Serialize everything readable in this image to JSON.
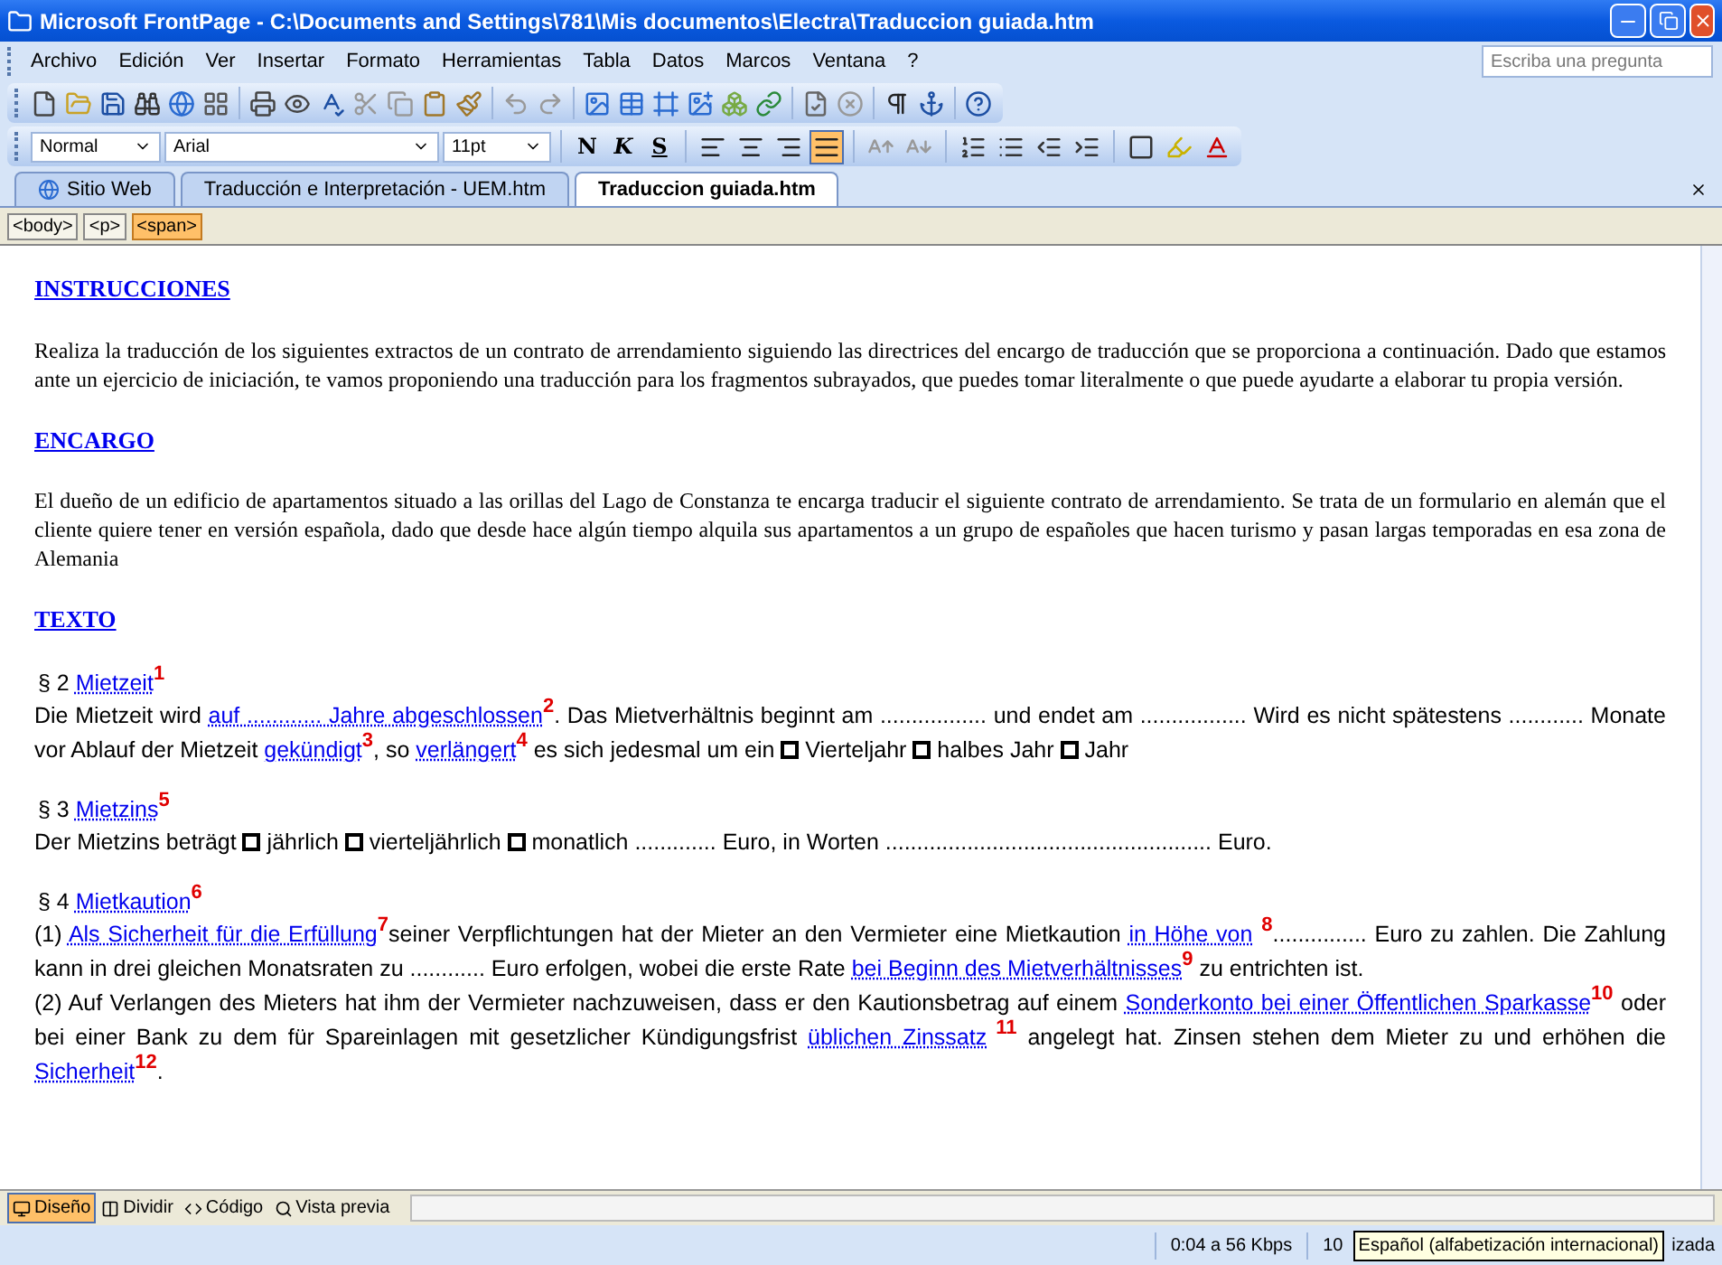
{
  "window": {
    "title": "Microsoft FrontPage - C:\\Documents and Settings\\781\\Mis documentos\\Electra\\Traduccion guiada.htm"
  },
  "menu": [
    "Archivo",
    "Edición",
    "Ver",
    "Insertar",
    "Formato",
    "Herramientas",
    "Tabla",
    "Datos",
    "Marcos",
    "Ventana",
    "?"
  ],
  "help_box": {
    "placeholder": "Escriba una pregunta"
  },
  "format_toolbar": {
    "style": "Normal",
    "font": "Arial",
    "size": "11pt",
    "text_buttons": [
      {
        "kind": "bold",
        "label": "N"
      },
      {
        "kind": "italic",
        "label": "K"
      },
      {
        "kind": "underline",
        "label": "S"
      }
    ],
    "alignment": [
      {
        "kind": "left",
        "selected": false
      },
      {
        "kind": "center",
        "selected": false
      },
      {
        "kind": "right",
        "selected": false
      },
      {
        "kind": "justify",
        "selected": true
      }
    ]
  },
  "tabs": [
    {
      "label": "Sitio Web",
      "kind": "site",
      "selected": false
    },
    {
      "label": "Traducción e Interpretación - UEM.htm",
      "kind": "page",
      "selected": false
    },
    {
      "label": "Traduccion guiada.htm",
      "kind": "page",
      "selected": true
    }
  ],
  "tag_bar": [
    {
      "label": "<body>",
      "selected": false
    },
    {
      "label": "<p>",
      "selected": false
    },
    {
      "label": "<span>",
      "selected": true
    }
  ],
  "document": [
    {
      "kind": "heading",
      "text": "INSTRUCCIONES"
    },
    {
      "kind": "intro",
      "runs": [
        {
          "kind": "text",
          "text": "Realiza la traducción de los siguientes extractos de un contrato de arrendamiento siguiendo las directrices del encargo de traducción que se proporciona a continuación. Dado que estamos ante un ejercicio de iniciación, te vamos proponiendo una traducción para los fragmentos subrayados, que puedes tomar literalmente o  que puede ayudarte a elaborar tu propia versión."
        }
      ]
    },
    {
      "kind": "heading",
      "text": "ENCARGO"
    },
    {
      "kind": "intro",
      "runs": [
        {
          "kind": "text",
          "text": "El dueño de un edificio de apartamentos situado a las orillas del Lago de Constanza  te encarga traducir el siguiente contrato de arrendamiento. Se trata de un formulario en alemán que el cliente quiere tener en versión española, dado que desde hace algún tiempo alquila sus apartamentos a un grupo de españoles que hacen turismo y pasan largas temporadas en esa zona de Alemania"
        }
      ]
    },
    {
      "kind": "heading",
      "text": "TEXTO"
    },
    {
      "kind": "section_title",
      "runs": [
        {
          "kind": "text",
          "text": "§ 2 "
        },
        {
          "kind": "link",
          "text": "Mietzeit"
        },
        {
          "kind": "note",
          "text": "1"
        }
      ]
    },
    {
      "kind": "clause",
      "runs": [
        {
          "kind": "text",
          "text": "Die Mietzeit wird "
        },
        {
          "kind": "link",
          "text": "auf ............ Jahre abgeschlossen"
        },
        {
          "kind": "note",
          "text": "2"
        },
        {
          "kind": "text",
          "text": ". Das Mietverhältnis beginnt am ................. und endet am ................. Wird es nicht spätestens ............ Monate vor Ablauf der Mietzeit "
        },
        {
          "kind": "link",
          "text": "gekündigt"
        },
        {
          "kind": "note",
          "text": "3"
        },
        {
          "kind": "text",
          "text": ", so "
        },
        {
          "kind": "link",
          "text": "verlängert"
        },
        {
          "kind": "note",
          "text": "4"
        },
        {
          "kind": "text",
          "text": "  es sich jedesmal um ein "
        },
        {
          "kind": "box"
        },
        {
          "kind": "text",
          "text": " Vierteljahr "
        },
        {
          "kind": "box"
        },
        {
          "kind": "text",
          "text": " halbes Jahr "
        },
        {
          "kind": "box"
        },
        {
          "kind": "text",
          "text": " Jahr"
        }
      ]
    },
    {
      "kind": "section_title",
      "runs": [
        {
          "kind": "text",
          "text": "§ 3 "
        },
        {
          "kind": "link",
          "text": "Mietzins"
        },
        {
          "kind": "note",
          "text": "5"
        }
      ]
    },
    {
      "kind": "clause",
      "runs": [
        {
          "kind": "text",
          "text": "Der Mietzins beträgt "
        },
        {
          "kind": "box"
        },
        {
          "kind": "text",
          "text": " jährlich "
        },
        {
          "kind": "box"
        },
        {
          "kind": "text",
          "text": " vierteljährlich "
        },
        {
          "kind": "box"
        },
        {
          "kind": "text",
          "text": " monatlich ............. Euro, in Worten .................................................... Euro."
        }
      ]
    },
    {
      "kind": "section_title",
      "runs": [
        {
          "kind": "text",
          "text": "§ 4 "
        },
        {
          "kind": "link",
          "text": "Mietkaution"
        },
        {
          "kind": "note",
          "text": "6"
        }
      ]
    },
    {
      "kind": "clause_tight",
      "runs": [
        {
          "kind": "text",
          "text": "(1) "
        },
        {
          "kind": "link",
          "text": "Als Sicherheit für die Erfüllung"
        },
        {
          "kind": "note",
          "text": "7"
        },
        {
          "kind": "text",
          "text": "seiner Verpflichtungen hat der Mieter an den Vermieter eine Mietkaution "
        },
        {
          "kind": "link",
          "text": "in Höhe von"
        },
        {
          "kind": "note",
          "text": "8",
          "gap_before": true
        },
        {
          "kind": "text",
          "text": "............... Euro zu zahlen. Die Zahlung kann in drei gleichen Monatsraten zu ............ Euro erfolgen, wobei die erste Rate "
        },
        {
          "kind": "link",
          "text": "bei Beginn des Mietverhältnisses"
        },
        {
          "kind": "note",
          "text": "9"
        },
        {
          "kind": "text",
          "text": " zu entrichten ist."
        }
      ]
    },
    {
      "kind": "clause",
      "runs": [
        {
          "kind": "text",
          "text": "(2) Auf Verlangen des Mieters hat ihm der Vermieter nachzuweisen, dass er den Kautionsbetrag auf einem "
        },
        {
          "kind": "link",
          "text": "Sonderkonto bei einer Öffentlichen Sparkasse"
        },
        {
          "kind": "note",
          "text": "10"
        },
        {
          "kind": "text",
          "text": " oder bei einer Bank zu dem für Spareinlagen mit gesetzlicher Kündigungsfrist "
        },
        {
          "kind": "link",
          "text": "üblichen Zinssatz"
        },
        {
          "kind": "note",
          "text": "11",
          "gap_before": true
        },
        {
          "kind": "text",
          "text": " angelegt hat. Zinsen stehen dem Mieter zu und erhöhen die "
        },
        {
          "kind": "link",
          "text": "Sicherheit"
        },
        {
          "kind": "note",
          "text": "12"
        },
        {
          "kind": "text",
          "text": "."
        }
      ]
    }
  ],
  "view_tabs": [
    {
      "label": "Diseño",
      "selected": true
    },
    {
      "label": "Dividir",
      "selected": false
    },
    {
      "label": "Código",
      "selected": false
    },
    {
      "label": "Vista previa",
      "selected": false
    }
  ],
  "status_bar": {
    "download_time": "0:04 a 56 Kbps",
    "field_2": "10",
    "tooltip": "Español (alfabetización internacional)",
    "field_3": "izada"
  }
}
